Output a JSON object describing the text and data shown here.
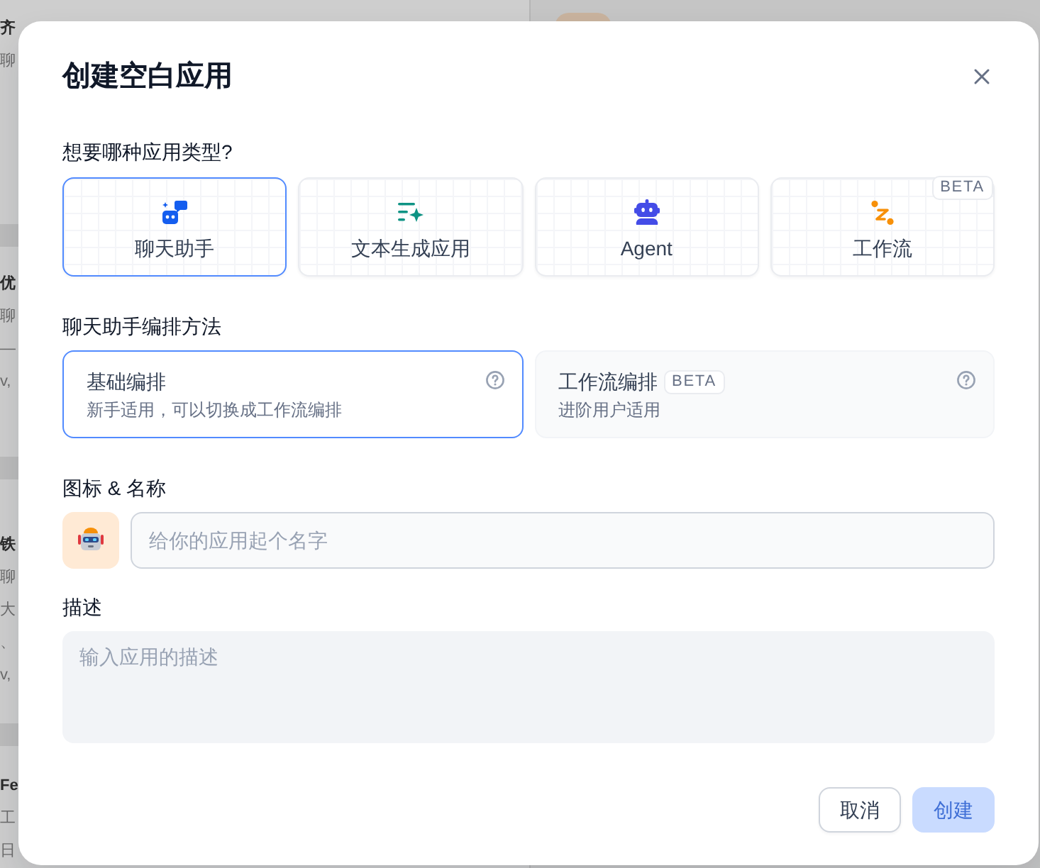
{
  "background_list": [
    {
      "title": "齐",
      "lines": [
        "聊"
      ]
    },
    {
      "title": "优",
      "lines": [
        "聊",
        "—",
        "v,"
      ]
    },
    {
      "title": "铁",
      "lines": [
        "聊",
        "大",
        "、",
        "v,"
      ]
    },
    {
      "title": "Fe",
      "lines": [
        "工",
        "日"
      ]
    }
  ],
  "dialog": {
    "title": "创建空白应用",
    "app_type_label": "想要哪种应用类型?",
    "app_types": [
      {
        "kind": "chat",
        "label": "聊天助手",
        "selected": true
      },
      {
        "kind": "text",
        "label": "文本生成应用",
        "selected": false
      },
      {
        "kind": "agent",
        "label": "Agent",
        "selected": false
      },
      {
        "kind": "workflow",
        "label": "工作流",
        "selected": false,
        "badge": "BETA"
      }
    ],
    "mode_label": "聊天助手编排方法",
    "modes": [
      {
        "title": "基础编排",
        "description": "新手适用，可以切换成工作流编排",
        "selected": true
      },
      {
        "title": "工作流编排",
        "badge": "BETA",
        "description": "进阶用户适用",
        "selected": false
      }
    ],
    "name_label": "图标 & 名称",
    "name_field": {
      "placeholder": "给你的应用起个名字"
    },
    "description_label": "描述",
    "description_field": {
      "placeholder": "输入应用的描述"
    },
    "buttons": [
      {
        "kind": "secondary",
        "label": "取消",
        "disabled": false
      },
      {
        "kind": "primary",
        "label": "创建",
        "disabled": true
      }
    ]
  }
}
